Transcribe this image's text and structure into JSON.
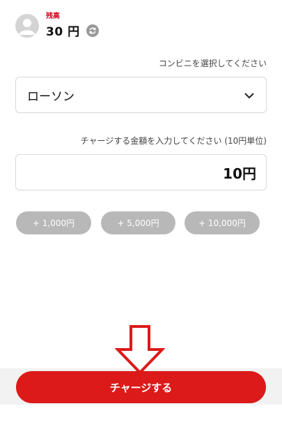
{
  "balance": {
    "label": "残高",
    "amount": "30 円",
    "refresh_icon": "refresh-icon"
  },
  "store": {
    "prompt": "コンビニを選択してください",
    "selected": "ローソン",
    "dropdown_icon": "chevron-down-icon"
  },
  "amount": {
    "prompt": "チャージする金額を入力してください (10円単位)",
    "value": "10円"
  },
  "quick_amounts": [
    "+ 1,000円",
    "+ 5,000円",
    "+ 10,000円"
  ],
  "charge_button": {
    "label": "チャージする"
  },
  "colors": {
    "accent": "#dc1a1a",
    "balance_label": "#d2001a",
    "quick_button": "#b8b8b8"
  }
}
